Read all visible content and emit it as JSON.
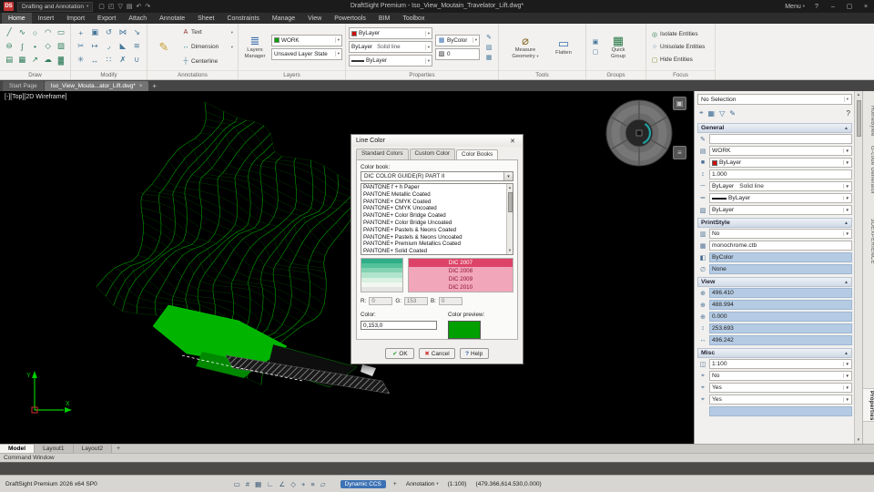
{
  "titlebar": {
    "workspace": "Drafting and Annotation",
    "title": "DraftSight Premium - Iso_View_Moutain_Travelator_Lift.dwg*",
    "menu": "Menu",
    "help": "?",
    "quick_icons": [
      "new",
      "open",
      "save",
      "print",
      "undo",
      "redo"
    ]
  },
  "menubar": {
    "items": [
      "Home",
      "Insert",
      "Import",
      "Export",
      "Attach",
      "Annotate",
      "Sheet",
      "Constraints",
      "Manage",
      "View",
      "Powertools",
      "BIM",
      "Toolbox"
    ],
    "active": "Home"
  },
  "ribbon": {
    "group_labels": [
      "Draw",
      "Modify",
      "Annotations",
      "Layers",
      "Properties",
      "Tools",
      "Groups",
      "Focus"
    ],
    "draw_icons": [
      "line",
      "polyline",
      "circle",
      "arc",
      "rectangle",
      "ellipse",
      "spline",
      "point",
      "polygon",
      "hatch",
      "region",
      "table",
      "ray",
      "cloud",
      "gradient"
    ],
    "modify_icons": [
      "move",
      "copy",
      "rotate",
      "mirror",
      "scale",
      "trim",
      "extend",
      "fillet",
      "chamfer",
      "offset",
      "explode",
      "stretch",
      "pattern",
      "erase",
      "weld"
    ],
    "annotations": {
      "text": "Text",
      "dimension": "Dimension",
      "centerline": "Centerline"
    },
    "layers": {
      "manager_line1": "Layers",
      "manager_line2": "Manager",
      "layer_name": "WORK",
      "layer_state": "Unsaved Layer State"
    },
    "properties": {
      "line_color": "ByLayer",
      "line_style": "ByLayer",
      "line_style2": "Solid line",
      "lineweight": "ByLayer",
      "hatch": "ByColor",
      "transparency": "0"
    },
    "tools": {
      "measure_line1": "Measure",
      "measure_line2": "Geometry",
      "flatten": "Flatten"
    },
    "groups": {
      "quick_line1": "Quick",
      "quick_line2": "Group"
    },
    "focus": {
      "isolate": "Isolate Entities",
      "unisolate": "Unisolate Entities",
      "hide": "Hide Entities"
    }
  },
  "doc_tabs": {
    "tabs": [
      {
        "label": "Start Page",
        "active": false,
        "closable": false
      },
      {
        "label": "Iso_View_Mouta...ator_Lift.dwg*",
        "active": true,
        "closable": true
      }
    ]
  },
  "canvas": {
    "viewport_label": "[-][Top][2D Wireframe]",
    "ucs_x": "X",
    "ucs_y": "Y"
  },
  "dialog": {
    "title": "Line Color",
    "tabs": [
      "Standard Colors",
      "Custom Color",
      "Color Books"
    ],
    "active_tab": "Color Books",
    "color_book_label": "Color book:",
    "color_book_value": "DIC COLOR GUIDE(R) PART II",
    "book_list": [
      "PANTONE f + h Paper",
      "PANTONE Metallic Coated",
      "PANTONE+ CMYK Coated",
      "PANTONE+ CMYK Uncoated",
      "PANTONE+ Color Bridge Coated",
      "PANTONE+ Color Bridge Uncoated",
      "PANTONE+ Pastels & Neons Coated",
      "PANTONE+ Pastels & Neons Uncoated",
      "PANTONE+ Premium Metallics Coated",
      "PANTONE+ Solid Coated"
    ],
    "gradient_colors": [
      "#2fae89",
      "#53c29b",
      "#83d2b2",
      "#b0e4cb",
      "#d9f1e2",
      "#f2f7f1",
      "#e4e4e2"
    ],
    "swatch_rows": [
      {
        "label": "DIC 2007",
        "selected": true
      },
      {
        "label": "DIC 2008",
        "selected": false
      },
      {
        "label": "DIC 2009",
        "selected": false
      },
      {
        "label": "DIC 2010",
        "selected": false
      }
    ],
    "rgb": {
      "r_label": "R:",
      "r": "0",
      "g_label": "G:",
      "g": "153",
      "b_label": "B:",
      "b": "0"
    },
    "color_label": "Color:",
    "color_value": "0,153,0",
    "preview_label": "Color preview:",
    "preview_color": "#00a000",
    "buttons": {
      "ok": "OK",
      "cancel": "Cancel",
      "help": "Help"
    }
  },
  "properties_panel": {
    "selection": "No Selection",
    "toolbar_icons": [
      "select-filter",
      "quick-select",
      "display-filter",
      "customize",
      "help"
    ],
    "sections": [
      {
        "title": "General",
        "rows": [
          {
            "icon": "note",
            "value": "",
            "type": "input"
          },
          {
            "icon": "layer",
            "value": "WORK",
            "type": "dropdown"
          },
          {
            "icon": "color",
            "value": "ByLayer",
            "type": "dropdown",
            "swatch": "#cc1111"
          },
          {
            "icon": "linescale",
            "value": "1.000",
            "type": "input"
          },
          {
            "icon": "linestyle",
            "value": "ByLayer",
            "value2": "Solid line",
            "type": "dropdown"
          },
          {
            "icon": "lineweight",
            "value": "ByLayer",
            "type": "dropdown",
            "linepreview": true
          },
          {
            "icon": "transparency",
            "value": "ByLayer",
            "type": "dropdown"
          }
        ]
      },
      {
        "title": "PrintStyle",
        "rows": [
          {
            "icon": "print",
            "value": "No",
            "type": "dropdown"
          },
          {
            "icon": "table",
            "value": "monochrome.ctb",
            "type": "input"
          },
          {
            "icon": "bycolor",
            "value": "ByColor",
            "type": "readonly"
          },
          {
            "icon": "none",
            "value": "None",
            "type": "readonly"
          }
        ]
      },
      {
        "title": "View",
        "rows": [
          {
            "icon": "viewx",
            "value": "496.410",
            "type": "readonly"
          },
          {
            "icon": "viewy",
            "value": "488.994",
            "type": "readonly"
          },
          {
            "icon": "viewz",
            "value": "0.000",
            "type": "readonly"
          },
          {
            "icon": "height",
            "value": "253.693",
            "type": "readonly"
          },
          {
            "icon": "width",
            "value": "496.242",
            "type": "readonly"
          }
        ]
      },
      {
        "title": "Misc",
        "rows": [
          {
            "icon": "annoscale",
            "value": "1:100",
            "type": "dropdown"
          },
          {
            "icon": "ucs",
            "value": "No",
            "type": "dropdown"
          },
          {
            "icon": "ucsicon",
            "value": "Yes",
            "type": "dropdown"
          },
          {
            "icon": "ucsorigin",
            "value": "Yes",
            "type": "dropdown"
          },
          {
            "icon": "blank",
            "value": "",
            "type": "readonly"
          }
        ]
      }
    ],
    "side_tabs": [
      "HomeByMe",
      "G-code Generator",
      "3DEXPERIENCE",
      "Properties"
    ],
    "active_side_tab": "Properties"
  },
  "bottom_tabs": {
    "tabs": [
      "Model",
      "Layout1",
      "Layout2"
    ],
    "active": "Model"
  },
  "command_window": {
    "title": "Command Window"
  },
  "statusbar": {
    "left": "DraftSight Premium 2026 x64 SP0",
    "icons": [
      "pointer",
      "snap",
      "grid",
      "ortho",
      "polar",
      "esnap",
      "gtrack",
      "lineweight",
      "dynamic-input"
    ],
    "dynamic_ccs": "Dynamic CCS",
    "annotation": "Annotation",
    "scale": "(1:100)",
    "coords": "(479.366,614.530,0.000)"
  },
  "colors": {
    "wireframe_green": "#00c000",
    "selection_blue": "#b5cbe3",
    "accent_blue": "#3c72b4"
  }
}
